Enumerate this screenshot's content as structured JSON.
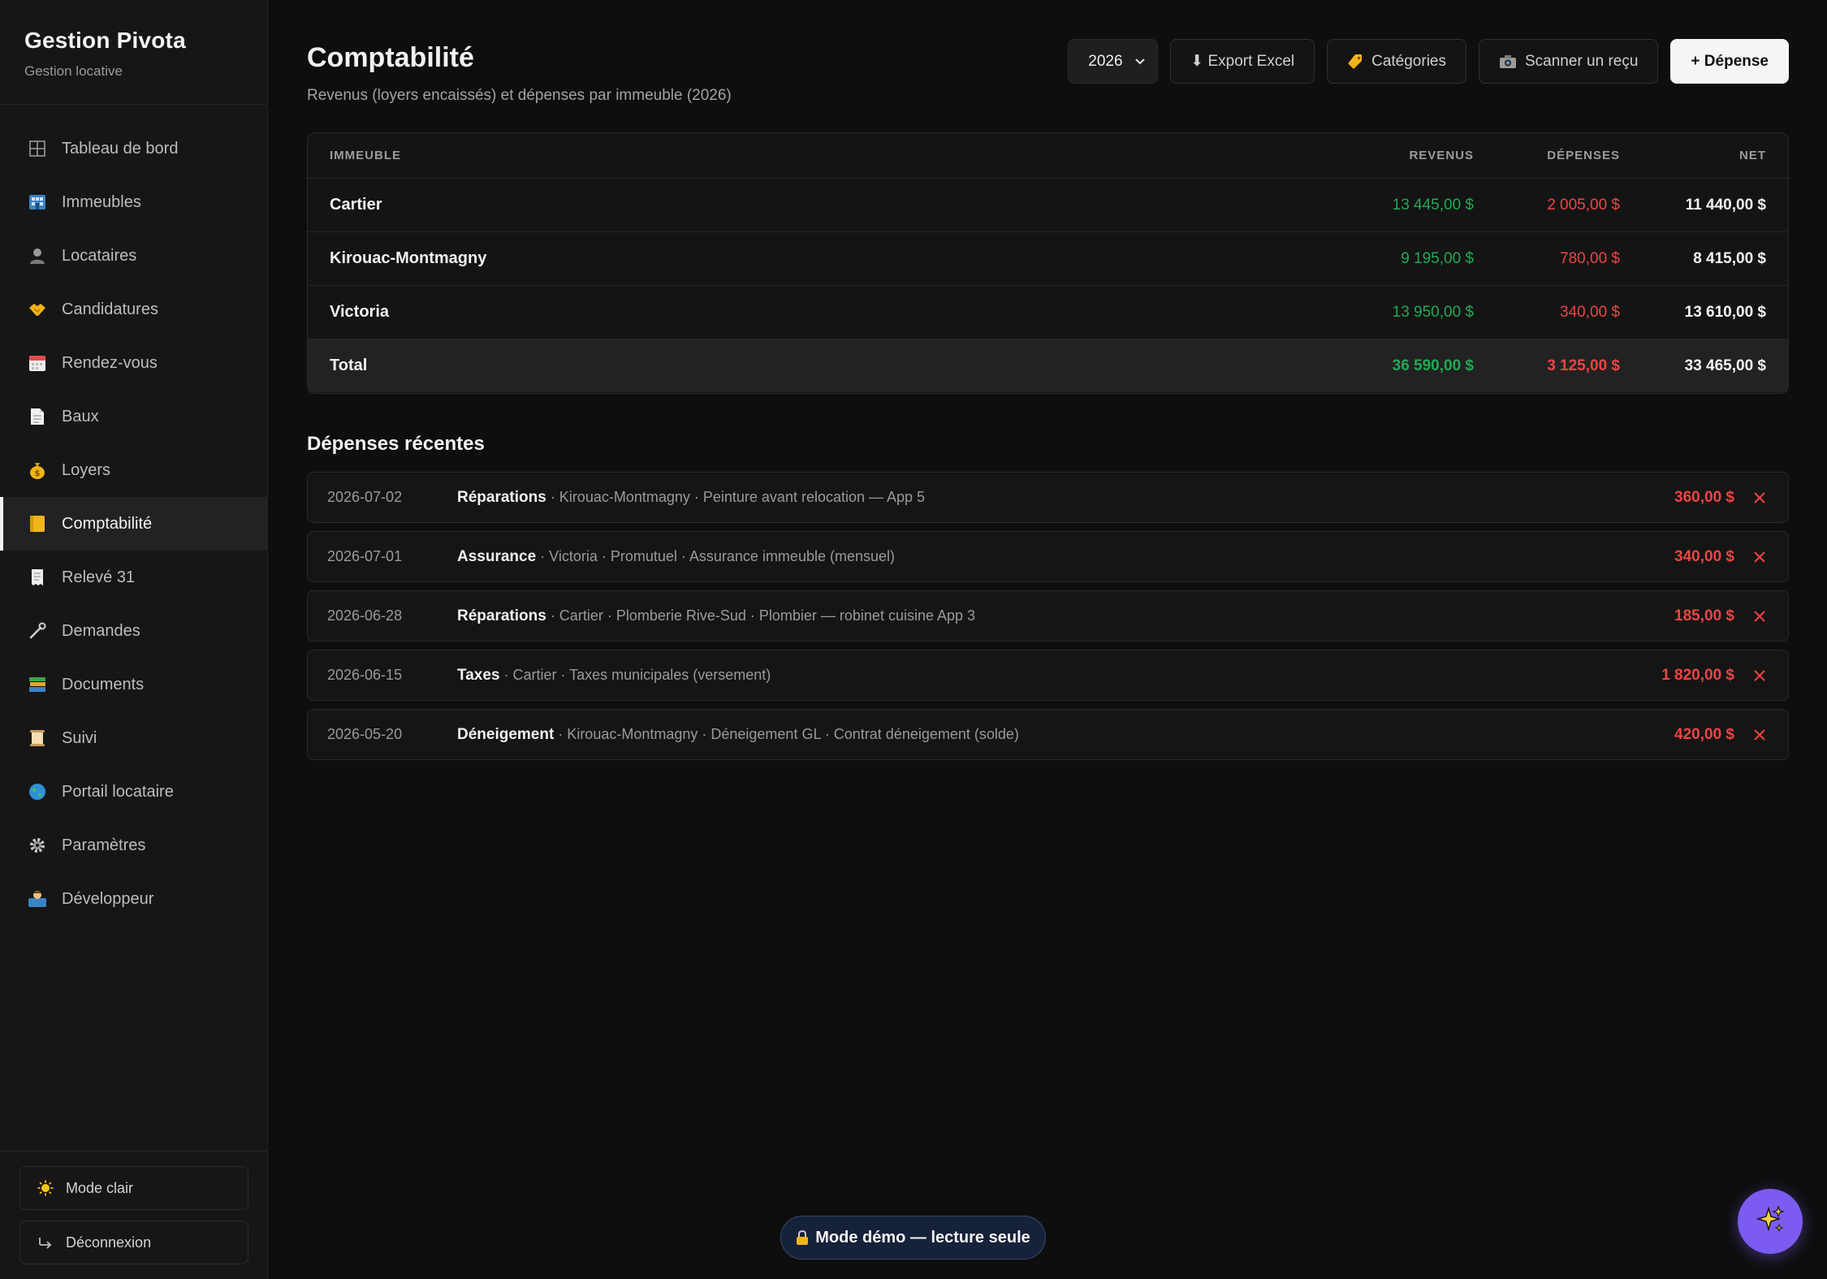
{
  "brand": {
    "title": "Gestion Pivota",
    "subtitle": "Gestion locative"
  },
  "sidebar": {
    "items": [
      {
        "label": "Tableau de bord",
        "icon": "grid-icon"
      },
      {
        "label": "Immeubles",
        "icon": "building-icon"
      },
      {
        "label": "Locataires",
        "icon": "person-icon"
      },
      {
        "label": "Candidatures",
        "icon": "handshake-icon"
      },
      {
        "label": "Rendez-vous",
        "icon": "calendar-icon"
      },
      {
        "label": "Baux",
        "icon": "document-icon"
      },
      {
        "label": "Loyers",
        "icon": "money-bag-icon"
      },
      {
        "label": "Comptabilité",
        "icon": "ledger-icon",
        "active": true
      },
      {
        "label": "Relevé 31",
        "icon": "receipt-icon"
      },
      {
        "label": "Demandes",
        "icon": "wrench-icon"
      },
      {
        "label": "Documents",
        "icon": "books-icon"
      },
      {
        "label": "Suivi",
        "icon": "scroll-icon"
      },
      {
        "label": "Portail locataire",
        "icon": "globe-icon"
      },
      {
        "label": "Paramètres",
        "icon": "gear-icon"
      },
      {
        "label": "Développeur",
        "icon": "developer-icon"
      }
    ],
    "bottom": {
      "light_mode": "Mode clair",
      "logout": "Déconnexion"
    }
  },
  "header": {
    "title": "Comptabilité",
    "subtitle": "Revenus (loyers encaissés) et dépenses par immeuble (2026)",
    "year_select": "2026",
    "export_label": "⬇ Export Excel",
    "categories_label": "Catégories",
    "scan_label": "Scanner un reçu",
    "add_label": "+ Dépense"
  },
  "summary": {
    "headers": {
      "building": "IMMEUBLE",
      "revenue": "REVENUS",
      "expenses": "DÉPENSES",
      "net": "NET"
    },
    "rows": [
      {
        "building": "Cartier",
        "revenue": "13 445,00 $",
        "expenses": "2 005,00 $",
        "net": "11 440,00 $"
      },
      {
        "building": "Kirouac-Montmagny",
        "revenue": "9 195,00 $",
        "expenses": "780,00 $",
        "net": "8 415,00 $"
      },
      {
        "building": "Victoria",
        "revenue": "13 950,00 $",
        "expenses": "340,00 $",
        "net": "13 610,00 $"
      }
    ],
    "total": {
      "building": "Total",
      "revenue": "36 590,00 $",
      "expenses": "3 125,00 $",
      "net": "33 465,00 $"
    }
  },
  "recent": {
    "title": "Dépenses récentes",
    "items": [
      {
        "date": "2026-07-02",
        "category": "Réparations",
        "details": " · Kirouac-Montmagny · Peinture avant relocation — App 5",
        "amount": "360,00 $"
      },
      {
        "date": "2026-07-01",
        "category": "Assurance",
        "details": " · Victoria · Promutuel · Assurance immeuble (mensuel)",
        "amount": "340,00 $"
      },
      {
        "date": "2026-06-28",
        "category": "Réparations",
        "details": " · Cartier · Plomberie Rive-Sud · Plombier — robinet cuisine App 3",
        "amount": "185,00 $"
      },
      {
        "date": "2026-06-15",
        "category": "Taxes",
        "details": " · Cartier · Taxes municipales (versement)",
        "amount": "1 820,00 $"
      },
      {
        "date": "2026-05-20",
        "category": "Déneigement",
        "details": " · Kirouac-Montmagny · Déneigement GL · Contrat déneigement (solde)",
        "amount": "420,00 $"
      }
    ]
  },
  "demo_banner": "Mode démo — lecture seule",
  "colors": {
    "positive": "#22a954",
    "negative": "#ef4444",
    "accent": "#7c5cf0"
  }
}
